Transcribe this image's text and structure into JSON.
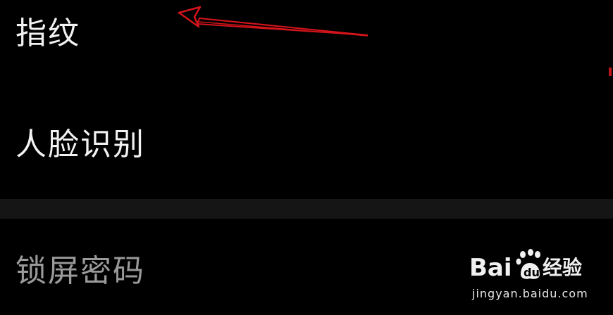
{
  "settings": {
    "items": [
      {
        "label": "指纹"
      },
      {
        "label": "人脸识别"
      },
      {
        "label": "锁屏密码"
      }
    ]
  },
  "annotation": {
    "arrow_color": "#d4141b"
  },
  "watermark": {
    "brand": "Baidu经验",
    "url": "jingyan.baidu.com"
  }
}
